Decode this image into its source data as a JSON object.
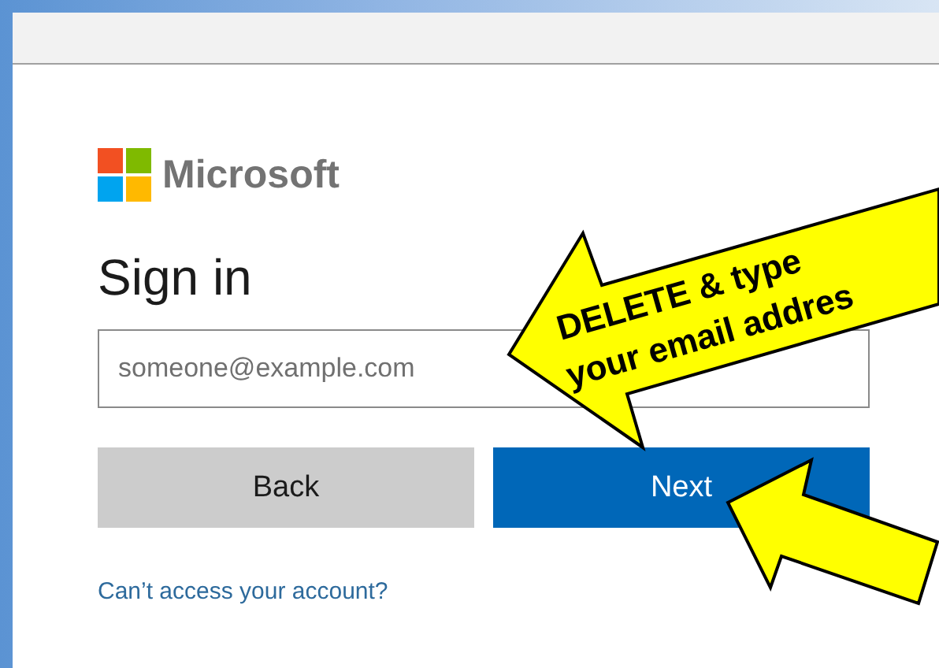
{
  "brand": {
    "name": "Microsoft"
  },
  "title": "Sign in",
  "email_field": {
    "placeholder": "someone@example.com"
  },
  "buttons": [
    {
      "label": "Back",
      "kind": "secondary"
    },
    {
      "label": "Next",
      "kind": "primary"
    }
  ],
  "link": "Can’t access your account?",
  "annotations": [
    {
      "kind": "callout",
      "lines": [
        "DELETE & type",
        "your email addres"
      ]
    },
    {
      "kind": "pointer"
    }
  ]
}
